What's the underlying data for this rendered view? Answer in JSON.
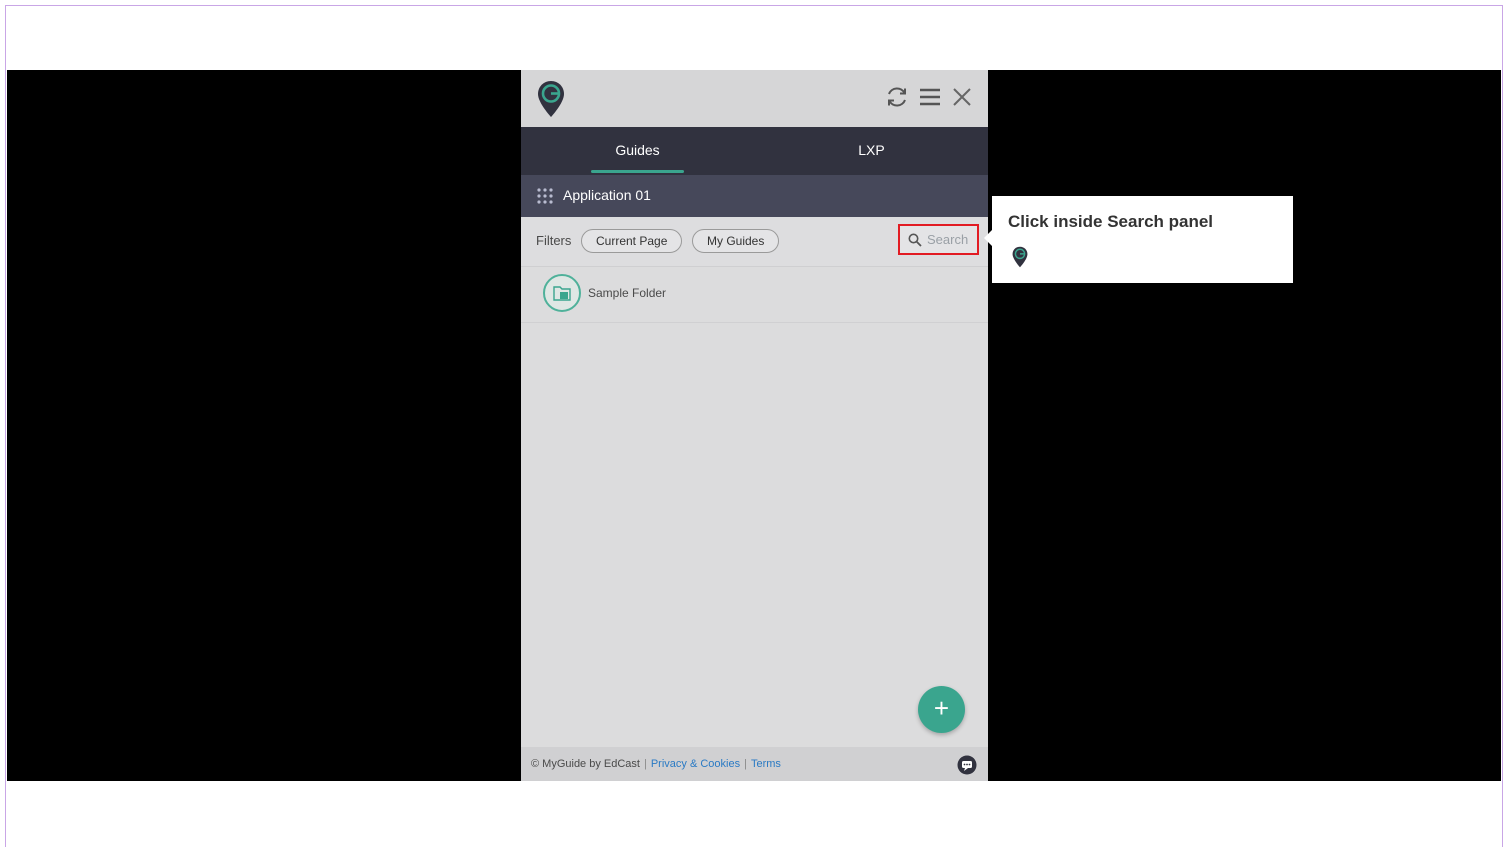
{
  "panel": {
    "icons": {
      "logo": "myguide-logo-icon",
      "refresh": "refresh-icon",
      "menu": "hamburger-menu-icon",
      "close": "close-icon"
    },
    "tabs": [
      {
        "label": "Guides",
        "active": true
      },
      {
        "label": "LXP",
        "active": false
      }
    ],
    "application": {
      "title": "Application 01",
      "icon": "apps-grid-icon"
    },
    "filters": {
      "label": "Filters",
      "chips": [
        "Current Page",
        "My Guides"
      ],
      "search_placeholder": "Search"
    },
    "list": [
      {
        "label": "Sample Folder",
        "icon": "folder-icon"
      }
    ],
    "fab_label": "+",
    "footer": {
      "copyright": "© MyGuide by EdCast",
      "privacy": "Privacy & Cookies",
      "terms": "Terms",
      "chat_icon": "chat-icon"
    }
  },
  "tooltip": {
    "text": "Click inside Search panel"
  },
  "colors": {
    "accent": "#3aa58e",
    "tab_bar": "#31323f",
    "app_bar": "#46485a",
    "highlight": "#e21b23",
    "link": "#2a7ac4"
  }
}
